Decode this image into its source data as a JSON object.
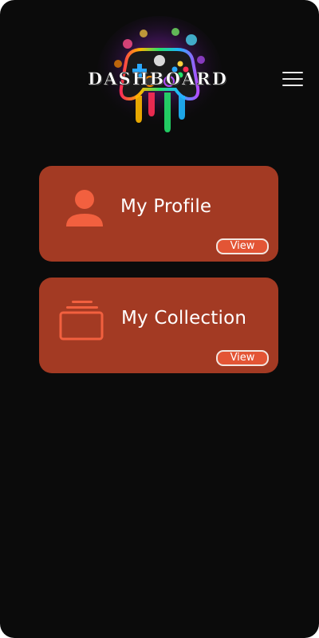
{
  "header": {
    "title": "DASHBOARD"
  },
  "cards": [
    {
      "label": "My Profile",
      "action": "View"
    },
    {
      "label": "My Collection",
      "action": "View"
    }
  ],
  "icons": {
    "logo": "gamepad-logo-icon",
    "menu": "hamburger-menu-icon",
    "profile": "user-icon",
    "collection": "stack-icon"
  },
  "colors": {
    "background": "#0b0b0b",
    "card": "#a33a23",
    "accent": "#f2603f",
    "button": "#e35535"
  }
}
